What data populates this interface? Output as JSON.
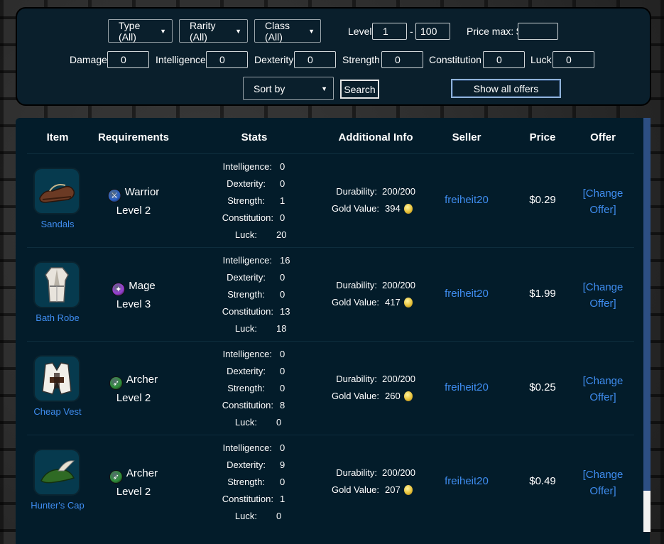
{
  "filters": {
    "type_select": "Type (All)",
    "rarity_select": "Rarity (All)",
    "class_select": "Class (All)",
    "level_label": "Level",
    "level_min": "1",
    "level_sep": "-",
    "level_max": "100",
    "price_max_label": "Price max: $",
    "price_max_value": "",
    "damage_label": "Damage",
    "damage_value": "0",
    "intelligence_label": "Intelligence",
    "intelligence_value": "0",
    "dexterity_label": "Dexterity",
    "dexterity_value": "0",
    "strength_label": "Strength",
    "strength_value": "0",
    "constitution_label": "Constitution",
    "constitution_value": "0",
    "luck_label": "Luck",
    "luck_value": "0",
    "sort_select": "Sort by",
    "search_button": "Search",
    "show_all_button": "Show all offers"
  },
  "table": {
    "headers": {
      "item": "Item",
      "requirements": "Requirements",
      "stats": "Stats",
      "additional_info": "Additional Info",
      "seller": "Seller",
      "price": "Price",
      "offer": "Offer"
    },
    "stat_labels": {
      "intelligence": "Intelligence:",
      "dexterity": "Dexterity:",
      "strength": "Strength:",
      "constitution": "Constitution:",
      "luck": "Luck:"
    },
    "info_labels": {
      "durability": "Durability:",
      "gold_value": "Gold Value:"
    },
    "offer_line1": "[Change",
    "offer_line2": "Offer]",
    "rows": [
      {
        "item": "Sandals",
        "icon": "sandals-icon",
        "class": "Warrior",
        "class_icon": "warrior-class-icon",
        "class_color": "#2a62c9",
        "level": "Level 2",
        "intelligence": "0",
        "dexterity": "0",
        "strength": "1",
        "constitution": "0",
        "luck": "20",
        "durability": "200/200",
        "gold_value": "394",
        "seller": "freiheit20",
        "price": "$0.29"
      },
      {
        "item": "Bath Robe",
        "icon": "bath-robe-icon",
        "class": "Mage",
        "class_icon": "mage-class-icon",
        "class_color": "#9a3fd6",
        "level": "Level 3",
        "intelligence": "16",
        "dexterity": "0",
        "strength": "0",
        "constitution": "13",
        "luck": "18",
        "durability": "200/200",
        "gold_value": "417",
        "seller": "freiheit20",
        "price": "$1.99"
      },
      {
        "item": "Cheap Vest",
        "icon": "cheap-vest-icon",
        "class": "Archer",
        "class_icon": "archer-class-icon",
        "class_color": "#2f8f3a",
        "level": "Level 2",
        "intelligence": "0",
        "dexterity": "0",
        "strength": "0",
        "constitution": "8",
        "luck": "0",
        "durability": "200/200",
        "gold_value": "260",
        "seller": "freiheit20",
        "price": "$0.25"
      },
      {
        "item": "Hunter's Cap",
        "icon": "hunters-cap-icon",
        "class": "Archer",
        "class_icon": "archer-class-icon",
        "class_color": "#2f8f3a",
        "level": "Level 2",
        "intelligence": "0",
        "dexterity": "9",
        "strength": "0",
        "constitution": "1",
        "luck": "0",
        "durability": "200/200",
        "gold_value": "207",
        "seller": "freiheit20",
        "price": "$0.49"
      }
    ]
  }
}
